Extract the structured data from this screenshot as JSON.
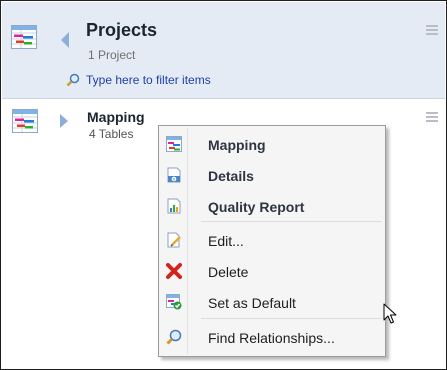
{
  "header": {
    "title": "Projects",
    "count": "1 Project",
    "filter_placeholder": "Type here to filter items",
    "icon": "project-diagram-icon",
    "back_icon": "triangle-left-icon",
    "search_icon": "magnifier-icon",
    "menu_icon": "hamburger-icon"
  },
  "row": {
    "name": "Mapping",
    "subtitle": "4 Tables",
    "icon": "project-diagram-icon",
    "expand_icon": "triangle-right-icon",
    "menu_icon": "hamburger-icon"
  },
  "context_menu": {
    "items": [
      {
        "label": "Mapping",
        "icon": "mapping-icon",
        "bold": true
      },
      {
        "label": "Details",
        "icon": "details-icon",
        "bold": true
      },
      {
        "label": "Quality Report",
        "icon": "report-chart-icon",
        "bold": true
      },
      {
        "label": "Edit...",
        "icon": "edit-document-icon",
        "bold": false
      },
      {
        "label": "Delete",
        "icon": "red-x-icon",
        "bold": false
      },
      {
        "label": "Set as Default",
        "icon": "set-default-icon",
        "bold": false
      },
      {
        "label": "Find Relationships...",
        "icon": "magnifier-icon",
        "bold": false
      }
    ]
  },
  "colors": {
    "header_bg": "#e4ebf5",
    "link_blue": "#1c3fa8",
    "delete_red": "#d2231c"
  }
}
